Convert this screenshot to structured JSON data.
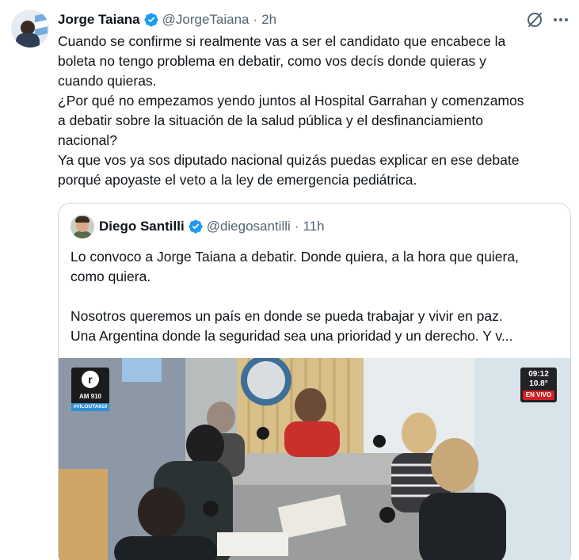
{
  "tweet": {
    "author_name": "Jorge Taiana",
    "author_handle": "@JorgeTaiana",
    "separator": "·",
    "time": "2h",
    "verified_icon": "verified-badge-icon",
    "actions": [
      "grok-icon",
      "more-icon"
    ],
    "text_lines": [
      "Cuando se confirme si realmente vas a ser el candidato que encabece la",
      "boleta no tengo problema en debatir, como vos decís donde quieras y",
      "cuando quieras.",
      "¿Por qué no empezamos yendo juntos al Hospital Garrahan y comenzamos",
      "a debatir sobre la situación de la salud pública y el desfinanciamiento",
      "nacional?",
      "Ya que vos ya sos diputado nacional quizás puedas explicar en ese debate",
      "porqué apoyaste el veto a la ley de emergencia pediátrica."
    ]
  },
  "quoted": {
    "author_name": "Diego Santilli",
    "author_handle": "@diegosantilli",
    "separator": "·",
    "time": "11h",
    "paragraph1_lines": [
      "Lo convoco a Jorge Taiana a debatir. Donde quiera, a la hora que quiera,",
      "como quiera."
    ],
    "paragraph2_lines": [
      "Nosotros queremos un país en donde se pueda trabajar y vivir en paz.",
      "Una Argentina donde la seguridad sea una prioridad y un derecho. Y v..."
    ],
    "media": {
      "station_logo_letter": "r",
      "station_tag": "AM 910",
      "hashtag": "#VILOUTA910",
      "clock": "09:12",
      "temperature": "10.8°",
      "live_label": "EN VIVO"
    }
  },
  "colors": {
    "text": "#0f1419",
    "secondary": "#536471",
    "border": "#cfd9de",
    "verified": "#1d9bf0",
    "live_red": "#d21f26"
  }
}
